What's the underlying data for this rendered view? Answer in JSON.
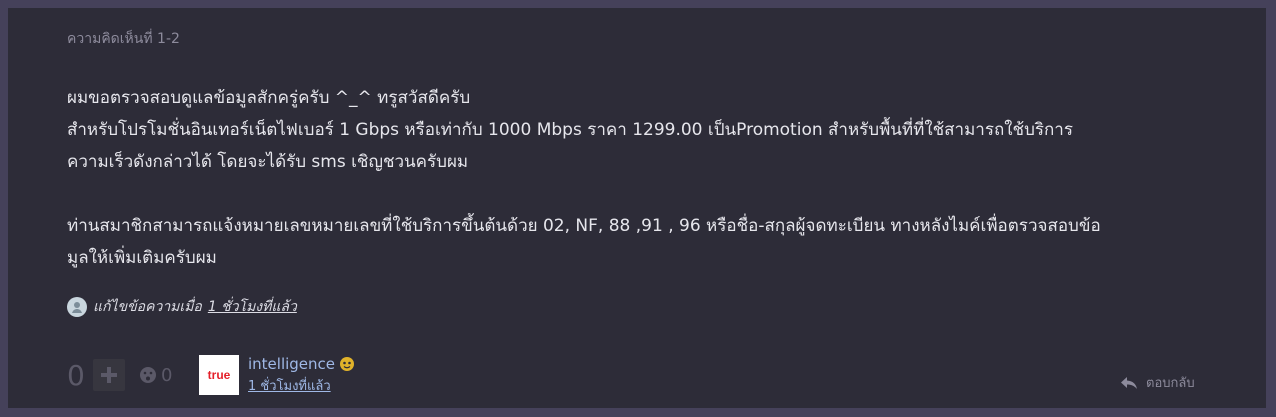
{
  "comment": {
    "header": "ความคิดเห็นที่ 1-2",
    "paragraph1": [
      "ผมขอตรวจสอบดูแลข้อมูลสักครู่ครับ ^_^ ทรูสวัสดีครับ",
      "สำหรับโปรโมชั่นอินเทอร์เน็ตไฟเบอร์ 1 Gbps หรือเท่ากับ 1000 Mbps ราคา 1299.00  เป็นPromotion สำหรับพื้นที่ที่ใช้สามารถใช้บริการ",
      "ความเร็วดังกล่าวได้ โดยจะได้รับ sms เชิญชวนครับผม"
    ],
    "paragraph2": [
      "ท่านสมาชิกสามารถแจ้งหมายเลขหมายเลขที่ใช้บริการขึ้นต้นด้วย 02, NF, 88 ,91 , 96 หรือชื่อ-สกุลผู้จดทะเบียน ทางหลังไมค์เพื่อตรวจสอบข้อ",
      "มูลให้เพิ่มเติมครับผม"
    ],
    "edit_label": "แก้ไขข้อความเมื่อ",
    "edit_time": "1 ชั่วโมงที่แล้ว",
    "score": "0",
    "emotion_count": "0",
    "author_avatar_text": "true",
    "author_name": "intelligence",
    "posted_time": "1 ชั่วโมงที่แล้ว",
    "reply_label": "ตอบกลับ"
  },
  "colors": {
    "page_bg": "#45415a",
    "card_bg": "#2d2c38",
    "link": "#9fb8e6",
    "brand_red": "#e4202a"
  }
}
